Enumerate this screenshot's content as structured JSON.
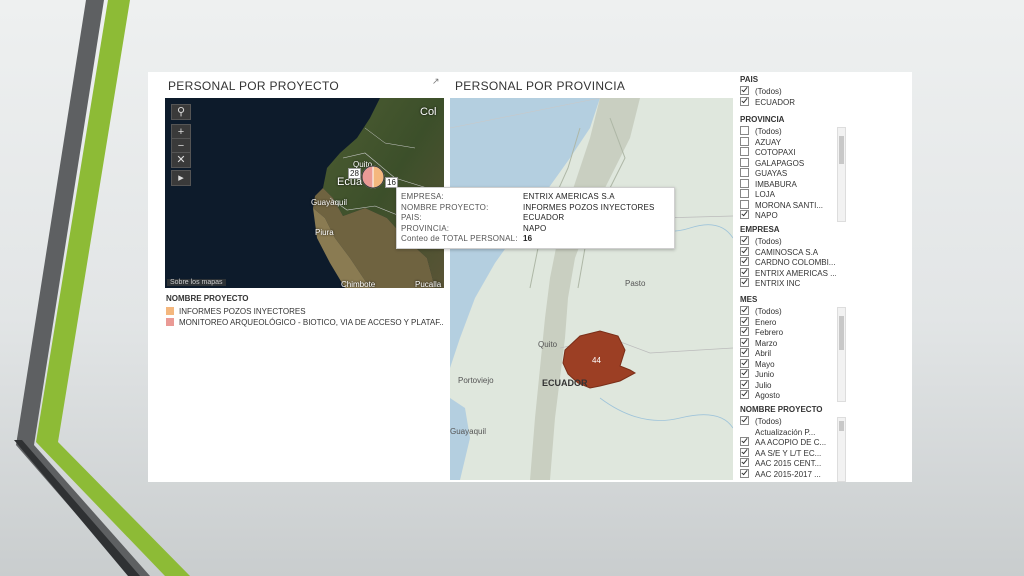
{
  "panel_left": {
    "title": "PERSONAL POR PROYECTO",
    "map_labels": {
      "quito": "Quito",
      "ecuador": "Ecua",
      "guayaquil": "Guayaquil",
      "piura": "Piura",
      "chimbote": "Chimbote",
      "colombia": "Col",
      "pucallpa": "Pucalla"
    },
    "bubble_left": "28",
    "bubble_right": "16",
    "attribution": "Sobre los mapas",
    "legend": {
      "title": "NOMBRE PROYECTO",
      "items": [
        {
          "label": "INFORMES POZOS INYECTORES",
          "color": "#f4b77e"
        },
        {
          "label": "MONITOREO ARQUEOLÓGICO - BIOTICO, VIA DE ACCESO Y PLATAF..",
          "color": "#ea9a95"
        }
      ]
    }
  },
  "panel_right": {
    "title": "PERSONAL POR PROVINCIA",
    "map_labels": {
      "pasto": "Pasto",
      "quito": "Quito",
      "ecuador": "ECUADOR",
      "portoviejo": "Portoviejo",
      "guayaquil": "Guayaquil"
    },
    "province_value": "44",
    "province_color": "#9c3f24"
  },
  "tooltip": {
    "rows": [
      {
        "key": "EMPRESA:",
        "value": "ENTRIX AMERICAS S.A"
      },
      {
        "key": "NOMBRE PROYECTO:",
        "value": "INFORMES POZOS INYECTORES"
      },
      {
        "key": "PAIS:",
        "value": "ECUADOR"
      },
      {
        "key": "PROVINCIA:",
        "value": "NAPO"
      },
      {
        "key": "Conteo de TOTAL PERSONAL:",
        "value": "16"
      }
    ]
  },
  "filters": {
    "pais": {
      "title": "PAIS",
      "items": [
        {
          "label": "(Todos)",
          "checked": true
        },
        {
          "label": "ECUADOR",
          "checked": true
        }
      ]
    },
    "provincia": {
      "title": "PROVINCIA",
      "items": [
        {
          "label": "(Todos)",
          "checked": false
        },
        {
          "label": "AZUAY",
          "checked": false
        },
        {
          "label": "COTOPAXI",
          "checked": false
        },
        {
          "label": "GALAPAGOS",
          "checked": false
        },
        {
          "label": "GUAYAS",
          "checked": false
        },
        {
          "label": "IMBABURA",
          "checked": false
        },
        {
          "label": "LOJA",
          "checked": false
        },
        {
          "label": "MORONA SANTI...",
          "checked": false
        },
        {
          "label": "NAPO",
          "checked": true
        }
      ]
    },
    "empresa": {
      "title": "EMPRESA",
      "items": [
        {
          "label": "(Todos)",
          "checked": true
        },
        {
          "label": "CAMINOSCA S.A",
          "checked": true
        },
        {
          "label": "CARDNO COLOMBI...",
          "checked": true
        },
        {
          "label": "ENTRIX AMERICAS ...",
          "checked": true
        },
        {
          "label": "ENTRIX INC",
          "checked": true
        }
      ]
    },
    "mes": {
      "title": "MES",
      "items": [
        {
          "label": "(Todos)",
          "checked": true
        },
        {
          "label": "Enero",
          "checked": true
        },
        {
          "label": "Febrero",
          "checked": true
        },
        {
          "label": "Marzo",
          "checked": true
        },
        {
          "label": "Abril",
          "checked": true
        },
        {
          "label": "Mayo",
          "checked": true
        },
        {
          "label": "Junio",
          "checked": true
        },
        {
          "label": "Julio",
          "checked": true
        },
        {
          "label": "Agosto",
          "checked": true
        }
      ]
    },
    "nombre_proyecto": {
      "title": "NOMBRE PROYECTO",
      "items": [
        {
          "label": "(Todos)",
          "checked": true
        },
        {
          "label": "Actualización P...",
          "checked": false
        },
        {
          "label": "AA ACOPIO DE C...",
          "checked": true
        },
        {
          "label": "AA S/E Y L/T EC...",
          "checked": true
        },
        {
          "label": "AAC 2015 CENT...",
          "checked": true
        },
        {
          "label": "AAC 2015-2017 ...",
          "checked": true
        }
      ]
    }
  }
}
